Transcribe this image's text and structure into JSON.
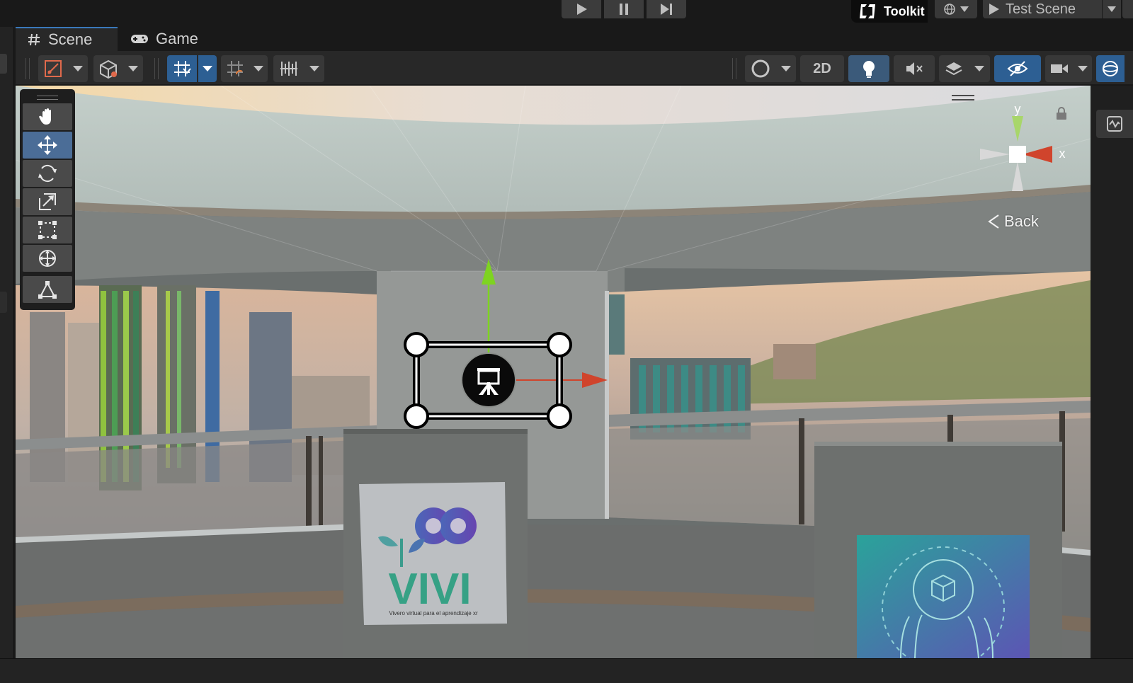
{
  "topbar": {
    "toolkit_label": "Toolkit",
    "test_scene_label": "Test Scene"
  },
  "tabs": [
    {
      "label": "Scene",
      "icon": "grid-hash-icon",
      "active": true
    },
    {
      "label": "Game",
      "icon": "gamepad-icon",
      "active": false
    }
  ],
  "toolbar": {
    "two_d_label": "2D"
  },
  "tools": [
    "hand-tool",
    "move-tool",
    "rotate-tool",
    "scale-tool",
    "rect-tool",
    "transform-tool",
    "custom-editor-tool"
  ],
  "selected_tool": "move-tool",
  "orientation_gizmo": {
    "y_label": "y",
    "x_label": "x",
    "back_label": "Back"
  },
  "scene": {
    "poster_title": "VIVI",
    "poster_subtitle": "Vivero virtual para  el aprendizaje xr"
  },
  "colors": {
    "accent_blue": "#2d5f93",
    "axis_y": "#7ed321",
    "axis_x": "#d0442c",
    "axis_neutral": "#d8d8d8"
  }
}
